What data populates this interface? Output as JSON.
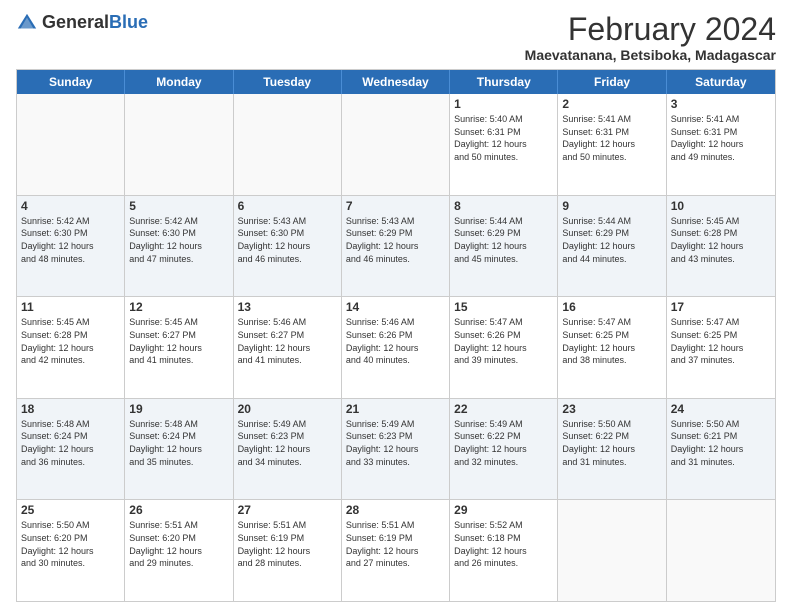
{
  "header": {
    "logo_general": "General",
    "logo_blue": "Blue",
    "title": "February 2024",
    "location": "Maevatanana, Betsiboka, Madagascar"
  },
  "calendar": {
    "days_of_week": [
      "Sunday",
      "Monday",
      "Tuesday",
      "Wednesday",
      "Thursday",
      "Friday",
      "Saturday"
    ],
    "weeks": [
      [
        {
          "day": "",
          "info": ""
        },
        {
          "day": "",
          "info": ""
        },
        {
          "day": "",
          "info": ""
        },
        {
          "day": "",
          "info": ""
        },
        {
          "day": "1",
          "info": "Sunrise: 5:40 AM\nSunset: 6:31 PM\nDaylight: 12 hours\nand 50 minutes."
        },
        {
          "day": "2",
          "info": "Sunrise: 5:41 AM\nSunset: 6:31 PM\nDaylight: 12 hours\nand 50 minutes."
        },
        {
          "day": "3",
          "info": "Sunrise: 5:41 AM\nSunset: 6:31 PM\nDaylight: 12 hours\nand 49 minutes."
        }
      ],
      [
        {
          "day": "4",
          "info": "Sunrise: 5:42 AM\nSunset: 6:30 PM\nDaylight: 12 hours\nand 48 minutes."
        },
        {
          "day": "5",
          "info": "Sunrise: 5:42 AM\nSunset: 6:30 PM\nDaylight: 12 hours\nand 47 minutes."
        },
        {
          "day": "6",
          "info": "Sunrise: 5:43 AM\nSunset: 6:30 PM\nDaylight: 12 hours\nand 46 minutes."
        },
        {
          "day": "7",
          "info": "Sunrise: 5:43 AM\nSunset: 6:29 PM\nDaylight: 12 hours\nand 46 minutes."
        },
        {
          "day": "8",
          "info": "Sunrise: 5:44 AM\nSunset: 6:29 PM\nDaylight: 12 hours\nand 45 minutes."
        },
        {
          "day": "9",
          "info": "Sunrise: 5:44 AM\nSunset: 6:29 PM\nDaylight: 12 hours\nand 44 minutes."
        },
        {
          "day": "10",
          "info": "Sunrise: 5:45 AM\nSunset: 6:28 PM\nDaylight: 12 hours\nand 43 minutes."
        }
      ],
      [
        {
          "day": "11",
          "info": "Sunrise: 5:45 AM\nSunset: 6:28 PM\nDaylight: 12 hours\nand 42 minutes."
        },
        {
          "day": "12",
          "info": "Sunrise: 5:45 AM\nSunset: 6:27 PM\nDaylight: 12 hours\nand 41 minutes."
        },
        {
          "day": "13",
          "info": "Sunrise: 5:46 AM\nSunset: 6:27 PM\nDaylight: 12 hours\nand 41 minutes."
        },
        {
          "day": "14",
          "info": "Sunrise: 5:46 AM\nSunset: 6:26 PM\nDaylight: 12 hours\nand 40 minutes."
        },
        {
          "day": "15",
          "info": "Sunrise: 5:47 AM\nSunset: 6:26 PM\nDaylight: 12 hours\nand 39 minutes."
        },
        {
          "day": "16",
          "info": "Sunrise: 5:47 AM\nSunset: 6:25 PM\nDaylight: 12 hours\nand 38 minutes."
        },
        {
          "day": "17",
          "info": "Sunrise: 5:47 AM\nSunset: 6:25 PM\nDaylight: 12 hours\nand 37 minutes."
        }
      ],
      [
        {
          "day": "18",
          "info": "Sunrise: 5:48 AM\nSunset: 6:24 PM\nDaylight: 12 hours\nand 36 minutes."
        },
        {
          "day": "19",
          "info": "Sunrise: 5:48 AM\nSunset: 6:24 PM\nDaylight: 12 hours\nand 35 minutes."
        },
        {
          "day": "20",
          "info": "Sunrise: 5:49 AM\nSunset: 6:23 PM\nDaylight: 12 hours\nand 34 minutes."
        },
        {
          "day": "21",
          "info": "Sunrise: 5:49 AM\nSunset: 6:23 PM\nDaylight: 12 hours\nand 33 minutes."
        },
        {
          "day": "22",
          "info": "Sunrise: 5:49 AM\nSunset: 6:22 PM\nDaylight: 12 hours\nand 32 minutes."
        },
        {
          "day": "23",
          "info": "Sunrise: 5:50 AM\nSunset: 6:22 PM\nDaylight: 12 hours\nand 31 minutes."
        },
        {
          "day": "24",
          "info": "Sunrise: 5:50 AM\nSunset: 6:21 PM\nDaylight: 12 hours\nand 31 minutes."
        }
      ],
      [
        {
          "day": "25",
          "info": "Sunrise: 5:50 AM\nSunset: 6:20 PM\nDaylight: 12 hours\nand 30 minutes."
        },
        {
          "day": "26",
          "info": "Sunrise: 5:51 AM\nSunset: 6:20 PM\nDaylight: 12 hours\nand 29 minutes."
        },
        {
          "day": "27",
          "info": "Sunrise: 5:51 AM\nSunset: 6:19 PM\nDaylight: 12 hours\nand 28 minutes."
        },
        {
          "day": "28",
          "info": "Sunrise: 5:51 AM\nSunset: 6:19 PM\nDaylight: 12 hours\nand 27 minutes."
        },
        {
          "day": "29",
          "info": "Sunrise: 5:52 AM\nSunset: 6:18 PM\nDaylight: 12 hours\nand 26 minutes."
        },
        {
          "day": "",
          "info": ""
        },
        {
          "day": "",
          "info": ""
        }
      ]
    ],
    "alt_rows": [
      1,
      3
    ]
  }
}
